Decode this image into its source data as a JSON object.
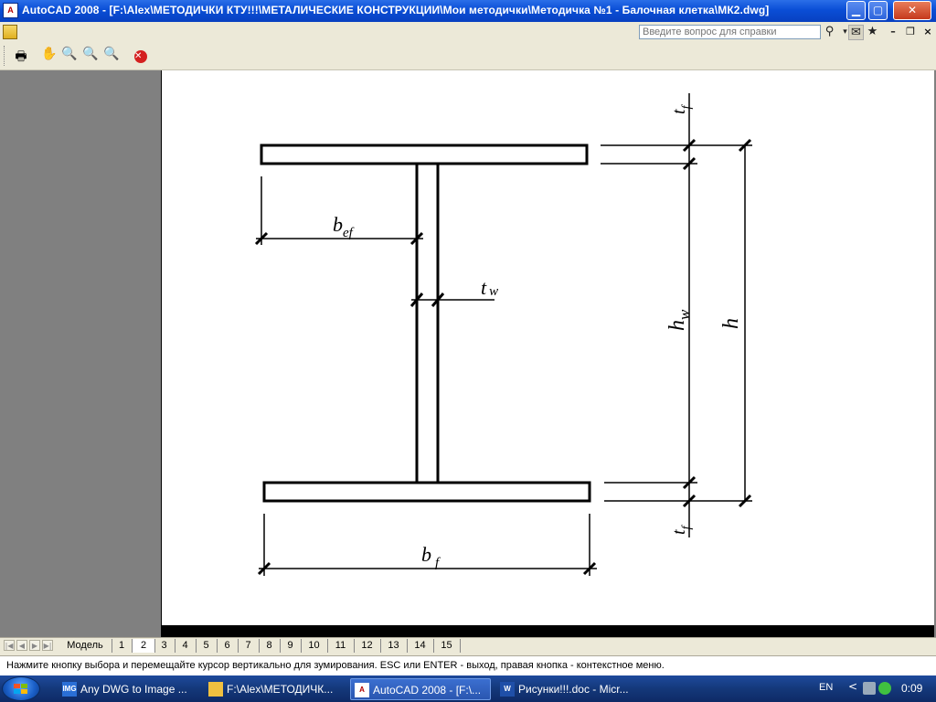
{
  "window": {
    "title": "AutoCAD 2008 - [F:\\Alex\\МЕТОДИЧКИ КТУ!!!\\МЕТАЛИЧЕСКИЕ КОНСТРУКЦИИ\\Мои методички\\Методичка №1 - Балочная клетка\\МК2.dwg]",
    "app_icon_label": "A",
    "controls": {
      "minimize": "▁",
      "maximize": "▢",
      "close": "✕"
    }
  },
  "help": {
    "placeholder": "Введите вопрос для справки",
    "search_icon": "magnifier-icon",
    "extra_icons": [
      "communication-center-icon",
      "favorites-star-icon"
    ]
  },
  "doc_controls": {
    "minimize": "–",
    "restore": "❐",
    "close": "×"
  },
  "toolbar": {
    "icons": [
      "plot-icon",
      "pan-icon",
      "zoom-realtime-icon",
      "zoom-window-icon",
      "zoom-previous-icon",
      "close-preview-icon"
    ]
  },
  "drawing": {
    "labels": {
      "bef_main": "b",
      "bef_sub": "ef",
      "tw_main": "t",
      "tw_sub": "w",
      "tf_top_main": "t",
      "tf_top_sub": "f",
      "hw_main": "h",
      "hw_sub": "w",
      "h": "h",
      "tf_bot_main": "t",
      "tf_bot_sub": "f",
      "bf_main": "b",
      "bf_sub": "f"
    }
  },
  "tabs": {
    "nav": [
      "|◀",
      "◀",
      "▶",
      "▶|"
    ],
    "items": [
      "Модель",
      "1",
      "2",
      "3",
      "4",
      "5",
      "6",
      "7",
      "8",
      "9",
      "10",
      "11",
      "12",
      "13",
      "14",
      "15"
    ],
    "active": "2"
  },
  "status": {
    "text": "Нажмите кнопку выбора и перемещайте курсор вертикально для зумирования. ESC или ENTER - выход, правая кнопка - контекстное меню."
  },
  "taskbar": {
    "items": [
      {
        "label": "Any DWG to Image ...",
        "icon": "IMG"
      },
      {
        "label": "F:\\Alex\\МЕТОДИЧК...",
        "icon": ""
      },
      {
        "label": "AutoCAD 2008 - [F:\\...",
        "icon": "A"
      },
      {
        "label": "Рисунки!!!.doc - Micr...",
        "icon": "W"
      }
    ],
    "active_index": 2,
    "lang": "EN",
    "tray_arrow": "<",
    "clock": "0:09"
  }
}
